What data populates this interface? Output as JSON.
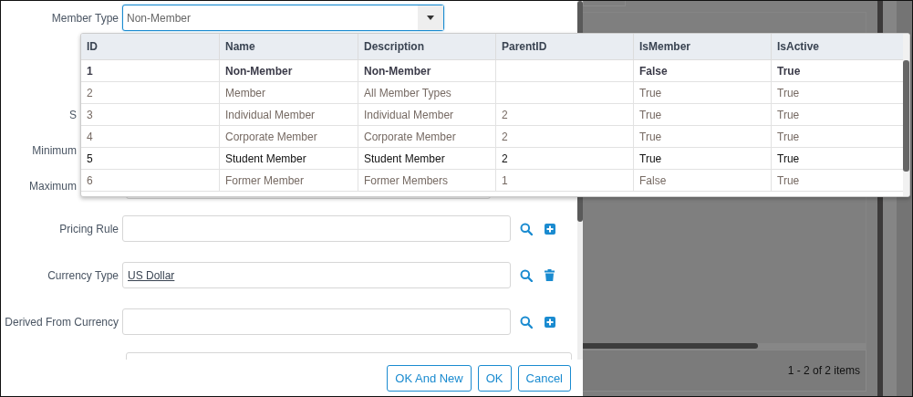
{
  "form": {
    "fields": [
      {
        "label": "Member Type",
        "kind": "dropdown",
        "value": "Non-Member"
      },
      {
        "label": "S",
        "kind": "text",
        "partial": true
      },
      {
        "label": "Minimum",
        "kind": "text",
        "partial": true
      },
      {
        "label": "Maximum",
        "kind": "text",
        "partial": true
      },
      {
        "label": "Pricing Rule",
        "kind": "lookup",
        "actions": [
          {
            "kind": "search"
          },
          {
            "kind": "add"
          }
        ]
      },
      {
        "label": "Currency Type",
        "kind": "lookup",
        "value": "US Dollar",
        "actions": [
          {
            "kind": "search"
          },
          {
            "kind": "delete"
          }
        ]
      },
      {
        "label": "Derived From Currency",
        "kind": "lookup",
        "actions": [
          {
            "kind": "search"
          },
          {
            "kind": "add"
          }
        ]
      },
      {
        "kind": "wide"
      }
    ]
  },
  "buttons": [
    "OK And New",
    "OK",
    "Cancel"
  ],
  "popup": {
    "columns": [
      "ID",
      "Name",
      "Description",
      "ParentID",
      "IsMember",
      "IsActive"
    ],
    "rows": [
      {
        "cells": [
          "1",
          "Non-Member",
          "Non-Member",
          "",
          "False",
          "True"
        ],
        "selected": true,
        "hovered": false
      },
      {
        "cells": [
          "2",
          "Member",
          "All Member Types",
          "",
          "True",
          "True"
        ],
        "selected": false,
        "hovered": false
      },
      {
        "cells": [
          "3",
          "Individual Member",
          "Individual Member",
          "2",
          "True",
          "True"
        ],
        "selected": false,
        "hovered": false
      },
      {
        "cells": [
          "4",
          "Corporate Member",
          "Corporate Member",
          "2",
          "True",
          "True"
        ],
        "selected": false,
        "hovered": false
      },
      {
        "cells": [
          "5",
          "Student Member",
          "Student Member",
          "2",
          "True",
          "True"
        ],
        "selected": false,
        "hovered": true
      },
      {
        "cells": [
          "6",
          "Former Member",
          "Former Members",
          "1",
          "False",
          "True"
        ],
        "selected": false,
        "hovered": false
      }
    ]
  },
  "background_page": {
    "pager": "1 - 2 of 2 items"
  }
}
